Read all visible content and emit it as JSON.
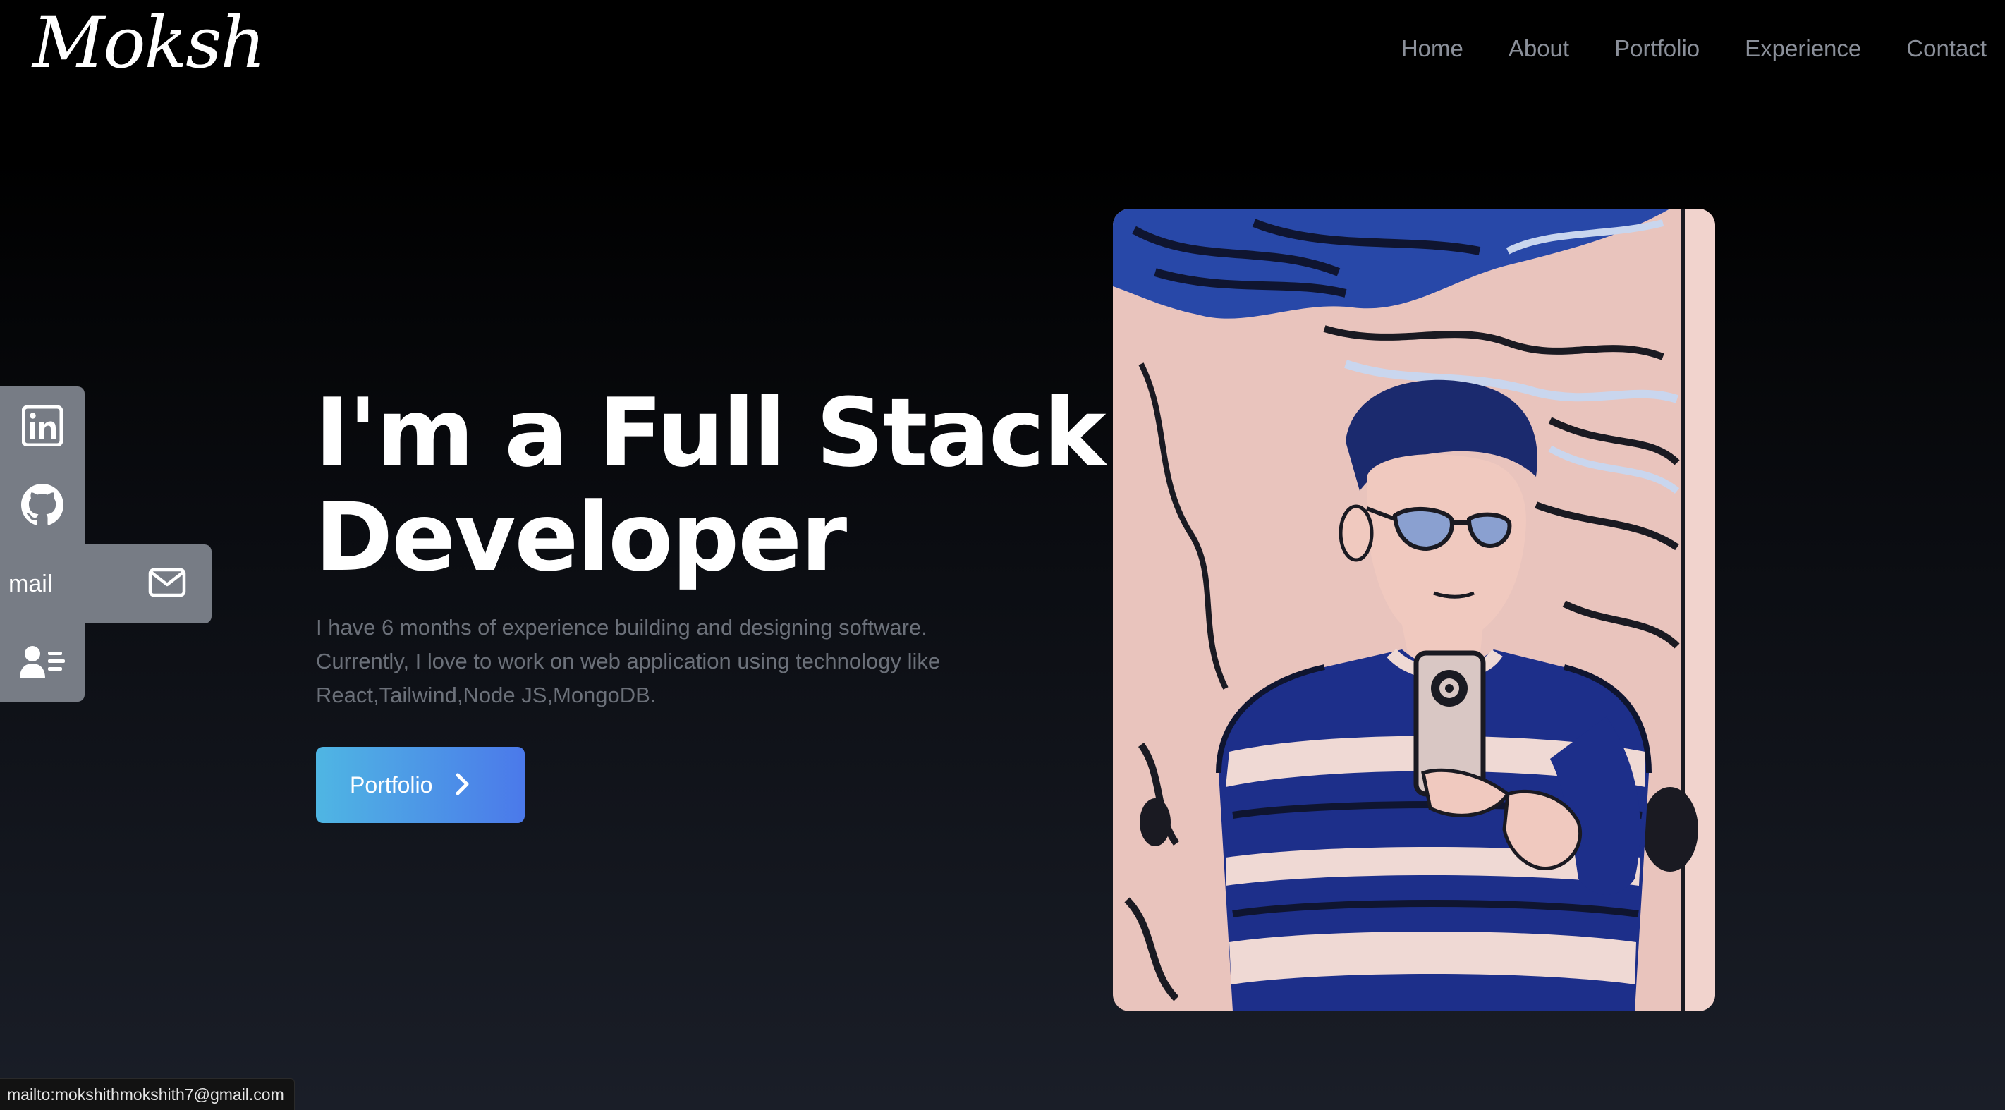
{
  "header": {
    "logo": "Moksh",
    "nav": [
      {
        "label": "Home"
      },
      {
        "label": "About"
      },
      {
        "label": "Portfolio"
      },
      {
        "label": "Experience"
      },
      {
        "label": "Contact"
      }
    ]
  },
  "social": {
    "items": [
      {
        "icon": "linkedin-icon"
      },
      {
        "icon": "github-icon"
      },
      {
        "icon": "mail-icon",
        "label": "mail"
      },
      {
        "icon": "resume-icon"
      }
    ]
  },
  "hero": {
    "title_line1": "I'm a Full Stack",
    "title_line2": "Developer",
    "description": "I have 6 months of experience building and designing software. Currently, I love to work on web application using technology like React,Tailwind,Node JS,MongoDB.",
    "cta_label": "Portfolio",
    "cta_icon": "chevron-right-icon"
  },
  "status_bar": {
    "url": "mailto:mokshithmokshith7@gmail.com"
  },
  "colors": {
    "background_top": "#000000",
    "background_bottom": "#1a1e28",
    "nav_text": "#8a8f99",
    "social_bg": "#777c85",
    "cta_gradient_start": "#4fb6e3",
    "cta_gradient_end": "#4b79ea",
    "description_text": "#6b7079"
  }
}
